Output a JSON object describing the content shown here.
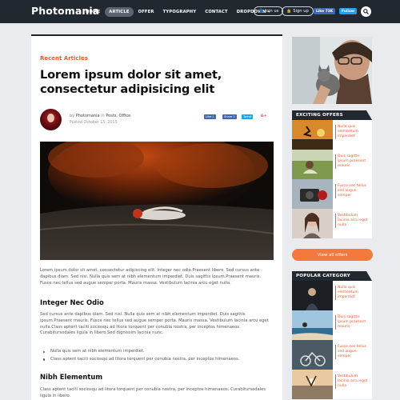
{
  "header": {
    "logo": "Photomania",
    "nav": [
      "HOME",
      "ARTICLE",
      "OFFER",
      "TYPOGRAPHY",
      "CONTACT",
      "DROPDOWN"
    ],
    "join_label": "Join us",
    "signup_label": "Sign up",
    "like_label": "Like 73K",
    "follow_label": "Follow"
  },
  "article": {
    "category": "Recent Articles",
    "title": "Lorem ipsum dolor sit amet, consectetur adipisicing elit",
    "by_prefix": "by",
    "author": "Photomania",
    "in_text": "in",
    "categories": "Posts, Office",
    "posted": "Posted October 15, 2015",
    "share": {
      "like": "Like 1",
      "share": "Share 1",
      "tweet": "Tweet",
      "gplus": "G+"
    },
    "intro": "Lorem ipsum dolor sit amet, consectetur adipiscing elit. Integer nec odio.Praesent libero. Sed cursus ante dapibus diam. Sed nisi. Nulla quis sem at nibh elementum imperdiet. Duis sagittis ipsum.Praesent mauris. Fusce nec tellus sed augue semper porta. Mauris massa. Vestibulum lacinia arcu eget nulla.",
    "h2_1": "Integer Nec Odio",
    "para2": "Sed cursus ante dapibus diam. Sed nisi. Nulla quis sem at nibh elementum imperdiet. Duis sagittis ipsum.Praesent mauris. Fusce nec tellus sed augue semper porta. Mauris massa. Vestibulum lacinia arcu eget nulla.Class aptent taciti sociosqu ad litora torquent per conubia nostra, per inceptos himenaeos. Curabitursodales ligula in libero.Sed dignissim lacinia nunc.",
    "bullets": [
      "Nulla quis sem at nibh elementum imperdiet.",
      "Class aptent taciti sociosqu ad litora torquent per conubia nostra, per inceptos himenaeos."
    ],
    "h2_2": "Nibh Elementum",
    "para3": "Class aptent taciti sociosqu ad litora torquent per conubia nostra, per inceptos himenaeos. Curabitursodales ligula in libero."
  },
  "sidebar": {
    "offers_title": "EXCITING OFFERS",
    "offers": [
      "Nulla quis elementum imperdiet",
      "Duis sagittis ipsum praesent mauris",
      "Fusce nec tellus sed augue semper",
      "Vestibulum lacinia arcu eget nulla"
    ],
    "view_all": "View all offers",
    "popular_title": "POPULAR CATEGORY",
    "popular": [
      "Nulla quis elementum imperdiet",
      "Duis sagittis ipsum praesent mauris",
      "Fusce nec tellus sed augue semper",
      "Vestibulum lacinia arcu eget nulla"
    ]
  },
  "colors": {
    "accent": "#f0592a",
    "dark": "#222830",
    "button": "#f4793d",
    "facebook": "#4267b2",
    "twitter": "#1da1f2"
  }
}
